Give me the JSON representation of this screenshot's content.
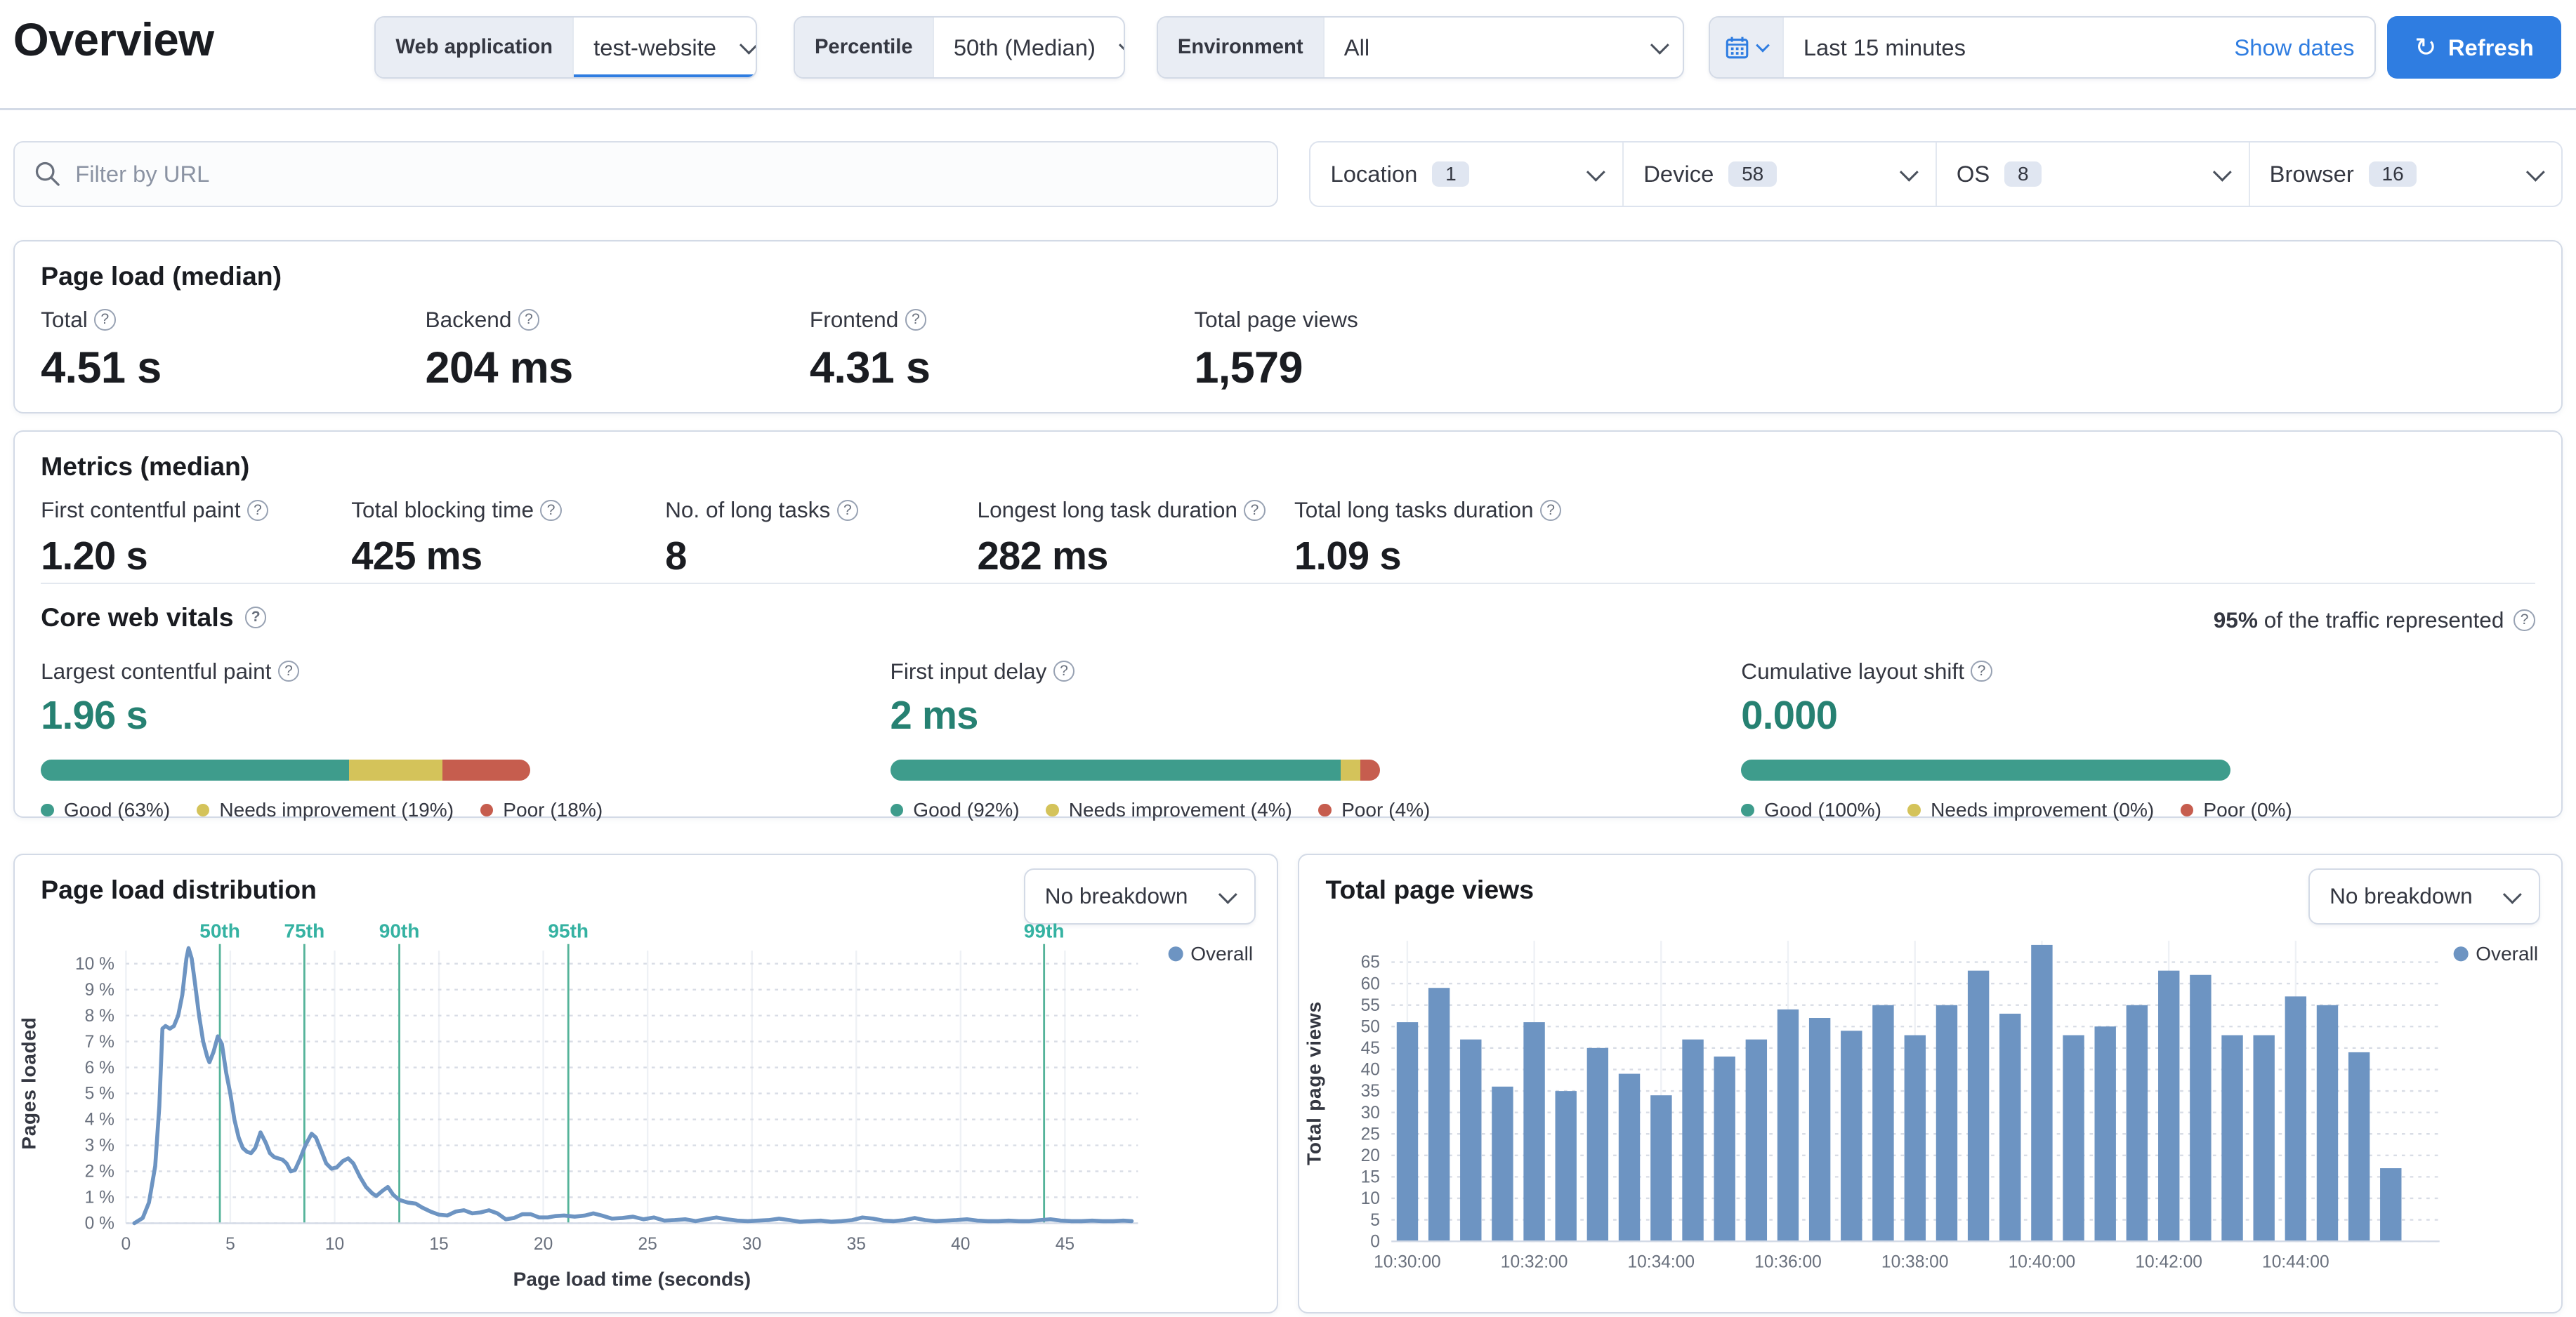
{
  "header": {
    "title": "Overview",
    "web_application": {
      "label": "Web application",
      "value": "test-website"
    },
    "percentile": {
      "label": "Percentile",
      "value": "50th (Median)"
    },
    "environment": {
      "label": "Environment",
      "value": "All"
    },
    "time_picker": {
      "value": "Last 15 minutes",
      "show_dates_label": "Show dates",
      "refresh_label": "Refresh"
    }
  },
  "filters": {
    "url_placeholder": "Filter by URL",
    "facets": [
      {
        "label": "Location",
        "count": "1"
      },
      {
        "label": "Device",
        "count": "58"
      },
      {
        "label": "OS",
        "count": "8"
      },
      {
        "label": "Browser",
        "count": "16"
      }
    ]
  },
  "page_load_panel": {
    "title": "Page load (median)",
    "stats": [
      {
        "label": "Total",
        "value": "4.51 s"
      },
      {
        "label": "Backend",
        "value": "204 ms"
      },
      {
        "label": "Frontend",
        "value": "4.31 s"
      },
      {
        "label": "Total page views",
        "value": "1,579"
      }
    ]
  },
  "metrics_panel": {
    "title": "Metrics (median)",
    "stats": [
      {
        "label": "First contentful paint",
        "value": "1.20 s"
      },
      {
        "label": "Total blocking time",
        "value": "425 ms"
      },
      {
        "label": "No. of long tasks",
        "value": "8"
      },
      {
        "label": "Longest long task duration",
        "value": "282 ms"
      },
      {
        "label": "Total long tasks duration",
        "value": "1.09 s"
      }
    ]
  },
  "core_web_vitals": {
    "title": "Core web vitals",
    "traffic_note_strong": "95%",
    "traffic_note_rest": " of the traffic represented",
    "legend_words": {
      "good": "Good",
      "needs": "Needs improvement",
      "poor": "Poor"
    },
    "vitals": [
      {
        "label": "Largest contentful paint",
        "value": "1.96 s",
        "good": 63,
        "needs": 19,
        "poor": 18
      },
      {
        "label": "First input delay",
        "value": "2 ms",
        "good": 92,
        "needs": 4,
        "poor": 4
      },
      {
        "label": "Cumulative layout shift",
        "value": "0.000",
        "good": 100,
        "needs": 0,
        "poor": 0
      }
    ]
  },
  "colors": {
    "primary_blue": "#2f7de1",
    "vis_blue": "#6d94c2",
    "good_teal": "#3e9c8c",
    "needs_yellow": "#d4c35a",
    "poor_red": "#c65d4e",
    "value_teal": "#268172",
    "percentile_teal": "#35b2a2",
    "percentile_line": "#54b399"
  },
  "chart_data": [
    {
      "type": "line",
      "title": "Page load distribution",
      "breakdown_label": "No breakdown",
      "xlabel": "Page load time (seconds)",
      "ylabel": "Pages loaded",
      "legend": "Overall",
      "xlim": [
        0,
        48.5
      ],
      "ylim": [
        0,
        10.5
      ],
      "x_ticks": [
        0,
        5,
        10,
        15,
        20,
        25,
        30,
        35,
        40,
        45
      ],
      "y_ticks": [
        0,
        1,
        2,
        3,
        4,
        5,
        6,
        7,
        8,
        9,
        10
      ],
      "y_tick_suffix": " %",
      "grid": true,
      "percentile_markers": [
        {
          "label": "50th",
          "x": 4.5
        },
        {
          "label": "75th",
          "x": 8.55
        },
        {
          "label": "90th",
          "x": 13.1
        },
        {
          "label": "95th",
          "x": 21.2
        },
        {
          "label": "99th",
          "x": 44.0
        }
      ],
      "series": [
        {
          "name": "Overall",
          "points": [
            [
              0.4,
              0
            ],
            [
              0.8,
              0.2
            ],
            [
              1.1,
              0.8
            ],
            [
              1.4,
              2.2
            ],
            [
              1.6,
              4.5
            ],
            [
              1.75,
              7.5
            ],
            [
              1.9,
              7.6
            ],
            [
              2.1,
              7.5
            ],
            [
              2.3,
              7.6
            ],
            [
              2.5,
              8.0
            ],
            [
              2.7,
              8.8
            ],
            [
              2.9,
              10.2
            ],
            [
              3.0,
              10.6
            ],
            [
              3.15,
              10.2
            ],
            [
              3.3,
              9.3
            ],
            [
              3.5,
              8.0
            ],
            [
              3.7,
              7.0
            ],
            [
              3.9,
              6.4
            ],
            [
              4.0,
              6.2
            ],
            [
              4.2,
              6.6
            ],
            [
              4.4,
              7.2
            ],
            [
              4.6,
              6.9
            ],
            [
              4.8,
              5.8
            ],
            [
              5.0,
              5.0
            ],
            [
              5.2,
              4.0
            ],
            [
              5.4,
              3.3
            ],
            [
              5.6,
              2.9
            ],
            [
              5.8,
              2.75
            ],
            [
              6.0,
              2.7
            ],
            [
              6.2,
              2.9
            ],
            [
              6.45,
              3.5
            ],
            [
              6.7,
              3.1
            ],
            [
              6.9,
              2.7
            ],
            [
              7.1,
              2.55
            ],
            [
              7.3,
              2.5
            ],
            [
              7.5,
              2.45
            ],
            [
              7.7,
              2.3
            ],
            [
              7.9,
              2.0
            ],
            [
              8.1,
              2.05
            ],
            [
              8.35,
              2.5
            ],
            [
              8.6,
              3.0
            ],
            [
              8.9,
              3.45
            ],
            [
              9.1,
              3.3
            ],
            [
              9.35,
              2.8
            ],
            [
              9.6,
              2.3
            ],
            [
              9.85,
              2.1
            ],
            [
              10.1,
              2.15
            ],
            [
              10.4,
              2.4
            ],
            [
              10.65,
              2.5
            ],
            [
              10.9,
              2.3
            ],
            [
              11.2,
              1.8
            ],
            [
              11.5,
              1.4
            ],
            [
              11.8,
              1.15
            ],
            [
              12.0,
              1.05
            ],
            [
              12.3,
              1.25
            ],
            [
              12.55,
              1.4
            ],
            [
              12.8,
              1.1
            ],
            [
              13.1,
              0.9
            ],
            [
              13.5,
              0.8
            ],
            [
              13.9,
              0.75
            ],
            [
              14.2,
              0.6
            ],
            [
              14.6,
              0.45
            ],
            [
              15.0,
              0.33
            ],
            [
              15.4,
              0.3
            ],
            [
              15.8,
              0.45
            ],
            [
              16.2,
              0.5
            ],
            [
              16.6,
              0.38
            ],
            [
              17.0,
              0.42
            ],
            [
              17.4,
              0.5
            ],
            [
              17.8,
              0.38
            ],
            [
              18.2,
              0.15
            ],
            [
              18.6,
              0.2
            ],
            [
              19.0,
              0.35
            ],
            [
              19.4,
              0.35
            ],
            [
              19.8,
              0.22
            ],
            [
              20.2,
              0.22
            ],
            [
              20.6,
              0.28
            ],
            [
              21.0,
              0.3
            ],
            [
              21.5,
              0.25
            ],
            [
              22.0,
              0.3
            ],
            [
              22.4,
              0.38
            ],
            [
              22.8,
              0.3
            ],
            [
              23.3,
              0.18
            ],
            [
              23.8,
              0.2
            ],
            [
              24.3,
              0.25
            ],
            [
              24.8,
              0.15
            ],
            [
              25.3,
              0.22
            ],
            [
              25.8,
              0.1
            ],
            [
              26.3,
              0.12
            ],
            [
              26.8,
              0.15
            ],
            [
              27.3,
              0.08
            ],
            [
              27.8,
              0.15
            ],
            [
              28.3,
              0.22
            ],
            [
              28.8,
              0.15
            ],
            [
              29.3,
              0.1
            ],
            [
              29.8,
              0.08
            ],
            [
              30.3,
              0.1
            ],
            [
              30.8,
              0.12
            ],
            [
              31.3,
              0.18
            ],
            [
              31.8,
              0.12
            ],
            [
              32.3,
              0.06
            ],
            [
              32.8,
              0.08
            ],
            [
              33.3,
              0.1
            ],
            [
              33.8,
              0.06
            ],
            [
              34.3,
              0.08
            ],
            [
              34.8,
              0.12
            ],
            [
              35.3,
              0.22
            ],
            [
              35.8,
              0.18
            ],
            [
              36.3,
              0.1
            ],
            [
              36.8,
              0.08
            ],
            [
              37.3,
              0.12
            ],
            [
              37.8,
              0.2
            ],
            [
              38.3,
              0.12
            ],
            [
              38.8,
              0.08
            ],
            [
              39.3,
              0.1
            ],
            [
              39.8,
              0.12
            ],
            [
              40.3,
              0.15
            ],
            [
              40.8,
              0.1
            ],
            [
              41.3,
              0.08
            ],
            [
              41.8,
              0.08
            ],
            [
              42.3,
              0.1
            ],
            [
              42.8,
              0.08
            ],
            [
              43.3,
              0.08
            ],
            [
              43.8,
              0.12
            ],
            [
              44.3,
              0.15
            ],
            [
              44.8,
              0.1
            ],
            [
              45.3,
              0.08
            ],
            [
              45.8,
              0.08
            ],
            [
              46.3,
              0.1
            ],
            [
              46.8,
              0.08
            ],
            [
              47.3,
              0.08
            ],
            [
              47.8,
              0.1
            ],
            [
              48.2,
              0.08
            ]
          ]
        }
      ]
    },
    {
      "type": "bar",
      "title": "Total page views",
      "breakdown_label": "No breakdown",
      "ylabel": "Total page views",
      "legend": "Overall",
      "y_ticks": [
        0,
        5,
        10,
        15,
        20,
        25,
        30,
        35,
        40,
        45,
        50,
        55,
        60,
        65
      ],
      "ylim": [
        0,
        65
      ],
      "grid": true,
      "x_tick_labels": [
        "10:30:00",
        "10:32:00",
        "10:34:00",
        "10:36:00",
        "10:38:00",
        "10:40:00",
        "10:42:00",
        "10:44:00"
      ],
      "x_tick_every": 4,
      "values": [
        51,
        59,
        47,
        36,
        51,
        35,
        45,
        39,
        34,
        47,
        43,
        47,
        54,
        52,
        49,
        55,
        48,
        55,
        63,
        53,
        69,
        48,
        50,
        55,
        63,
        62,
        48,
        48,
        57,
        55,
        44,
        17
      ]
    }
  ]
}
